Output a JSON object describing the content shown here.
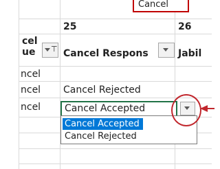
{
  "top_cell": {
    "label": "Cancel"
  },
  "columns": {
    "col24": {
      "header_line1": "cel",
      "header_line2": "ue"
    },
    "col25": {
      "number": "25",
      "header": "Cancel Respons"
    },
    "col26": {
      "number": "26",
      "header": "Jabil"
    }
  },
  "rows": [
    {
      "col24": "ncel",
      "col25": ""
    },
    {
      "col24": "ncel",
      "col25": "Cancel Rejected"
    },
    {
      "col24": "ncel",
      "col25": "Cancel Accepted"
    }
  ],
  "dropdown": {
    "options": [
      "Cancel Accepted",
      "Cancel Rejected"
    ],
    "selected": "Cancel Accepted"
  },
  "annotation": {
    "color": "#c1272d"
  }
}
